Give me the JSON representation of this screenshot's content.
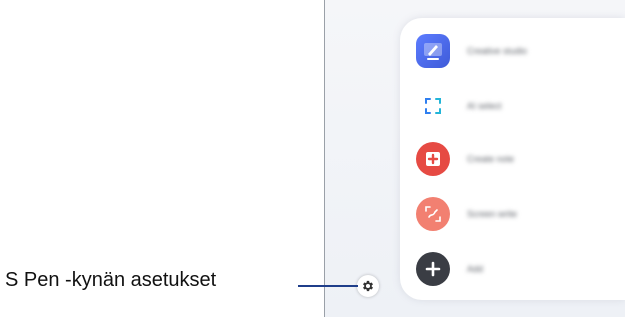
{
  "callout": {
    "label": "S Pen -kynän asetukset"
  },
  "menu": {
    "items": [
      {
        "label": "Creative studio",
        "icon": "creative-studio-icon"
      },
      {
        "label": "AI select",
        "icon": "ai-select-icon"
      },
      {
        "label": "Create note",
        "icon": "create-note-icon"
      },
      {
        "label": "Screen write",
        "icon": "screen-write-icon"
      },
      {
        "label": "Add",
        "icon": "add-icon"
      }
    ]
  },
  "settings": {
    "icon": "gear-icon"
  },
  "colors": {
    "callout_line": "#1f3e8a",
    "creative_studio": "#4f6ef0",
    "ai_select": "#2f7ff0",
    "create_note": "#e64a43",
    "screen_write": "#f28071",
    "add": "#3a3d44"
  }
}
